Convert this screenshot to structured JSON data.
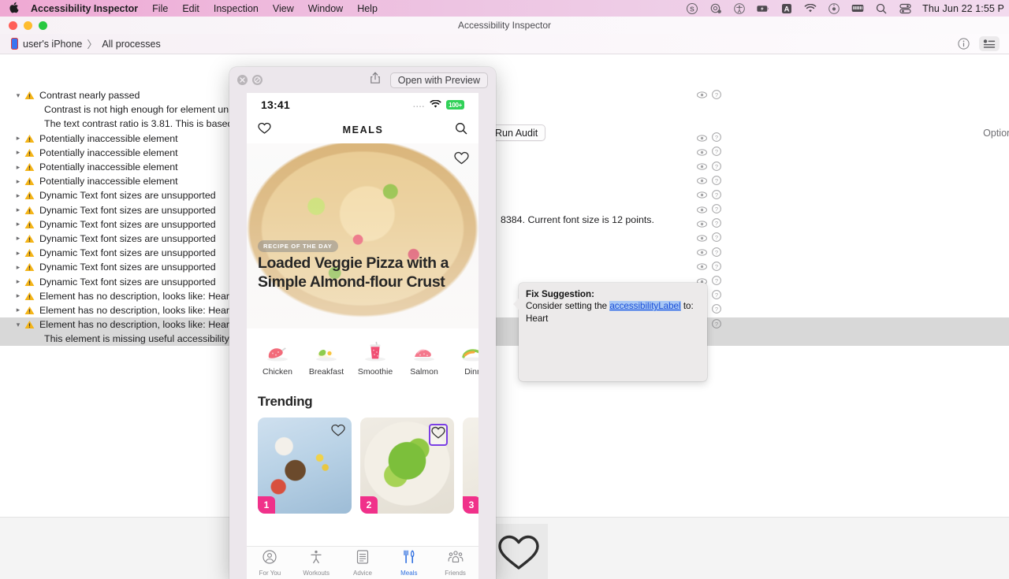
{
  "menubar": {
    "apple_glyph": "",
    "items": [
      "Accessibility Inspector",
      "File",
      "Edit",
      "Inspection",
      "View",
      "Window",
      "Help"
    ],
    "status_icons": [
      "skype-icon",
      "screenshot-icon",
      "accessibility-icon",
      "battery-charging-icon",
      "input-source-a-icon",
      "wifi-icon",
      "clock-dot-icon",
      "keyboard-icon",
      "spotlight-search-icon",
      "control-center-icon"
    ],
    "clock": "Thu Jun 22  1:55 P"
  },
  "window": {
    "title": "Accessibility Inspector",
    "breadcrumb": {
      "device": "user's iPhone",
      "separator": "〉",
      "scope": "All processes"
    },
    "info_icon": "info-circle-icon",
    "list_icon": "detail-list-icon"
  },
  "toolbar": {
    "run_audit_label": "Run Audit",
    "options_label": "Option"
  },
  "audit": {
    "rows": [
      {
        "disclosure": "open",
        "label": "Contrast nearly passed",
        "selected": false
      },
      {
        "type": "detail",
        "label": "Contrast is not high enough for element un"
      },
      {
        "type": "detail",
        "label": "The text contrast ratio is 3.81. This is based",
        "label_right": "8384. Current font size is 12 points."
      },
      {
        "disclosure": "closed",
        "label": "Potentially inaccessible element",
        "selected": false
      },
      {
        "disclosure": "closed",
        "label": "Potentially inaccessible element",
        "selected": false
      },
      {
        "disclosure": "closed",
        "label": "Potentially inaccessible element",
        "selected": false
      },
      {
        "disclosure": "closed",
        "label": "Potentially inaccessible element",
        "selected": false
      },
      {
        "disclosure": "closed",
        "label": "Dynamic Text font sizes are unsupported",
        "selected": false
      },
      {
        "disclosure": "closed",
        "label": "Dynamic Text font sizes are unsupported",
        "selected": false
      },
      {
        "disclosure": "closed",
        "label": "Dynamic Text font sizes are unsupported",
        "selected": false
      },
      {
        "disclosure": "closed",
        "label": "Dynamic Text font sizes are unsupported",
        "selected": false
      },
      {
        "disclosure": "closed",
        "label": "Dynamic Text font sizes are unsupported",
        "selected": false
      },
      {
        "disclosure": "closed",
        "label": "Dynamic Text font sizes are unsupported",
        "selected": false
      },
      {
        "disclosure": "closed",
        "label": "Dynamic Text font sizes are unsupported",
        "selected": false
      },
      {
        "disclosure": "closed",
        "label": "Element has no description, looks like: Heart",
        "selected": false
      },
      {
        "disclosure": "closed",
        "label": "Element has no description, looks like: Heart",
        "selected": false
      },
      {
        "disclosure": "open",
        "label": "Element has no description, looks like: Heart",
        "selected": true
      },
      {
        "type": "detail",
        "label": "This element is missing useful accessibility",
        "selected": true
      }
    ],
    "row_eye_icon": "eye-icon",
    "row_help_icon": "question-circle-icon"
  },
  "quicklook": {
    "close_icon": "close-icon",
    "markup_icon": "no-entry-icon",
    "share_icon": "share-icon",
    "open_with_preview_label": "Open with Preview"
  },
  "phone": {
    "status": {
      "time": "13:41",
      "signal_dots": "....",
      "wifi_icon": "wifi-icon",
      "battery": "100+"
    },
    "nav": {
      "heart_icon": "heart-icon",
      "title": "MEALS",
      "search_icon": "search-icon"
    },
    "hero": {
      "badge": "RECIPE OF THE DAY",
      "title": "Loaded Veggie Pizza with a Simple Almond-flour Crust",
      "fav_icon": "heart-icon"
    },
    "categories": [
      {
        "label": "Chicken",
        "icon": "chicken-icon"
      },
      {
        "label": "Breakfast",
        "icon": "egg-icon"
      },
      {
        "label": "Smoothie",
        "icon": "smoothie-cup-icon"
      },
      {
        "label": "Salmon",
        "icon": "salmon-icon"
      },
      {
        "label": "Dinn",
        "icon": "dinner-icon"
      }
    ],
    "trending": {
      "title": "Trending",
      "cards": [
        {
          "number": "1",
          "fav_icon": "heart-icon",
          "selected": false
        },
        {
          "number": "2",
          "fav_icon": "heart-icon",
          "selected": true
        },
        {
          "number": "3",
          "fav_icon": "heart-icon",
          "selected": false
        }
      ]
    },
    "tabs": [
      {
        "label": "For You",
        "icon": "person-circle-icon",
        "active": false
      },
      {
        "label": "Workouts",
        "icon": "figure-accessibility-icon",
        "active": false
      },
      {
        "label": "Advice",
        "icon": "document-icon",
        "active": false
      },
      {
        "label": "Meals",
        "icon": "fork-knife-icon",
        "active": true
      },
      {
        "label": "Friends",
        "icon": "people-group-icon",
        "active": false
      }
    ]
  },
  "fix_suggestion": {
    "heading": "Fix Suggestion:",
    "text_before": "Consider setting the",
    "link": "accessibilityLabel",
    "text_after": "to:",
    "value": "Heart"
  },
  "bottom_panel": {
    "element_preview_icon": "heart-outline-icon"
  },
  "colors": {
    "menubar_pink": "#eeb0d8",
    "accent_blue": "#2f6fe0",
    "selection_purple": "#7b3fe4",
    "badge_pink": "#f0318a",
    "battery_green": "#31d158",
    "warning_yellow": "#f5b517",
    "link_blue": "#1b4fd8"
  }
}
